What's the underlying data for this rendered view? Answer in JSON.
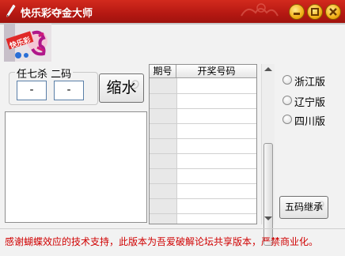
{
  "window": {
    "title": "快乐彩夺金大师",
    "logo_text": "快乐彩"
  },
  "colors": {
    "titlebar": "#c01e16",
    "title_buttons": "#f3b018",
    "footer_text": "#d00000"
  },
  "kill_group": {
    "title": "任七杀 二码",
    "field1_value": "-",
    "field2_value": "-"
  },
  "buttons": {
    "shrink": "缩水",
    "five_code": "五码继承"
  },
  "grid": {
    "columns": [
      "期号",
      "开奖号码"
    ],
    "rows": []
  },
  "versions": [
    {
      "label": "浙江版"
    },
    {
      "label": "辽宁版"
    },
    {
      "label": "四川版"
    }
  ],
  "footer": {
    "notice": "感谢蝴蝶效应的技术支持，此版本为吾爱破解论坛共享版本，严禁商业化。"
  }
}
